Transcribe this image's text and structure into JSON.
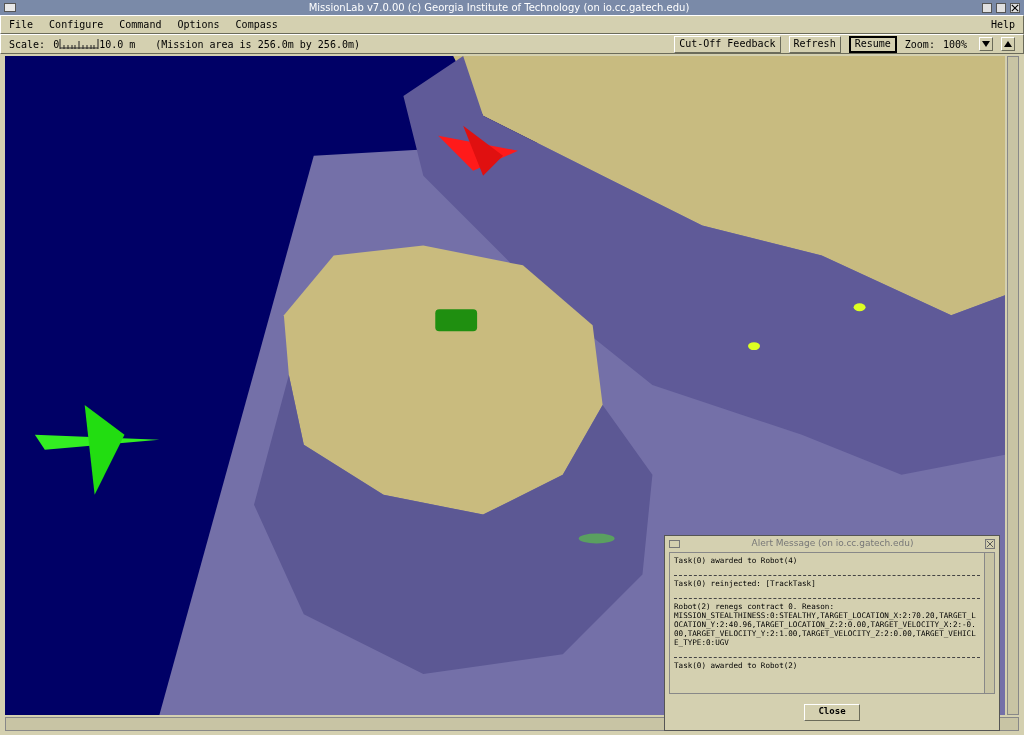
{
  "window": {
    "title": "MissionLab  v7.0.00  (c) Georgia Institute of Technology (on io.cc.gatech.edu)"
  },
  "menu": [
    {
      "label": "File"
    },
    {
      "label": "Configure"
    },
    {
      "label": "Command"
    },
    {
      "label": "Options"
    },
    {
      "label": "Compass"
    }
  ],
  "help_menu": {
    "label": "Help"
  },
  "toolbar": {
    "scale_label": "Scale:",
    "scale_min": "0",
    "scale_max": "10.0 m",
    "mission_area": "(Mission area is 256.0m by 256.0m)",
    "buttons": [
      {
        "label": "Cut-Off Feedback",
        "selected": false
      },
      {
        "label": "Refresh",
        "selected": false
      },
      {
        "label": "Resume",
        "selected": true
      }
    ],
    "zoom_label": "Zoom:",
    "zoom_value": "100%"
  },
  "alert": {
    "title": "Alert Message (on io.cc.gatech.edu)",
    "messages": [
      {
        "lines": [
          "Task(0) awarded to Robot(4)"
        ]
      },
      {
        "lines": [
          "Task(0) reinjected: [TrackTask]"
        ]
      },
      {
        "lines": [
          "Robot(2) renegs contract 0. Reason:",
          "MISSION_STEALTHINESS:0:STEALTHY,TARGET_LOCATION_X:2:70.20,TARGET_LOCATION_Y:2:40.96,TARGET_LOCATION_Z:2:0.00,TARGET_VELOCITY_X:2:-0.00,TARGET_VELOCITY_Y:2:1.00,TARGET_VELOCITY_Z:2:0.00,TARGET_VEHICLE_TYPE:0:UGV"
        ]
      },
      {
        "lines": [
          "Task(0) awarded to Robot(2)"
        ]
      }
    ],
    "close": "Close"
  }
}
